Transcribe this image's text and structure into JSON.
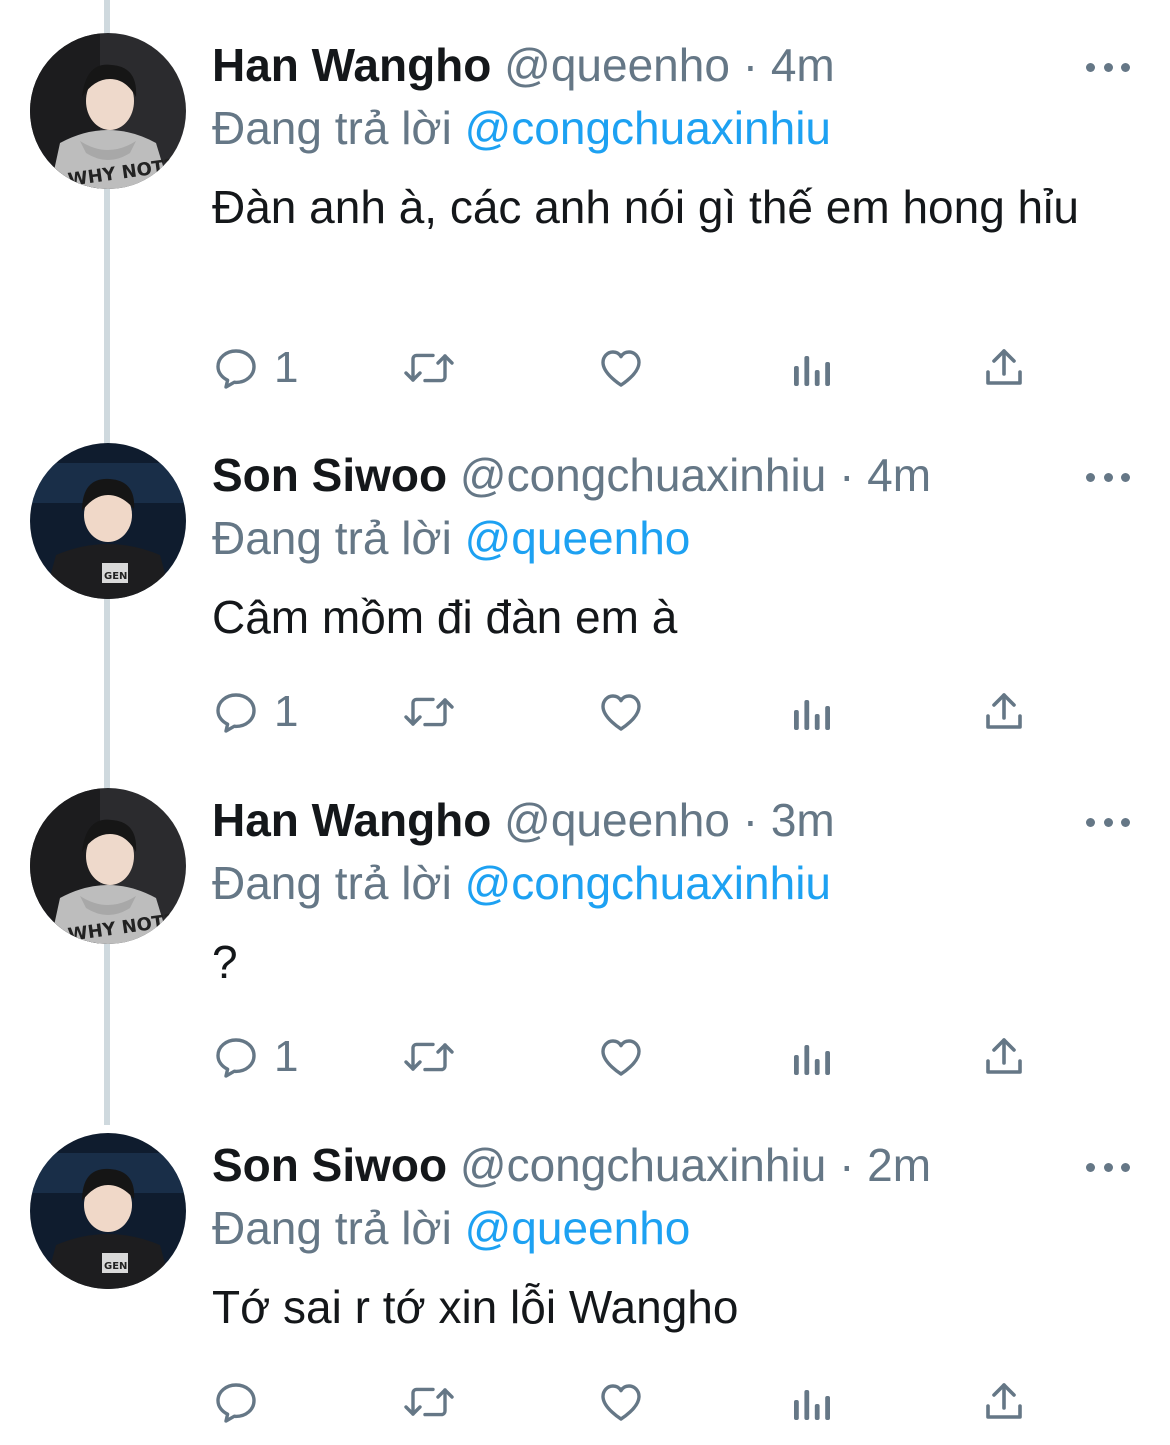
{
  "tweets": [
    {
      "name": "Han Wangho",
      "handle": "@queenho",
      "separator": "·",
      "time": "4m",
      "replying_prefix": "Đang trả lời",
      "replying_to": "@congchuaxinhiu",
      "text": "Đàn anh à, các anh nói gì thế em hong hỉu",
      "reply_count": "1",
      "avatar_shirt_text": "WHY NOT?!"
    },
    {
      "name": "Son Siwoo",
      "handle": "@congchuaxinhiu",
      "separator": "·",
      "time": "4m",
      "replying_prefix": "Đang trả lời",
      "replying_to": "@queenho",
      "text": "Câm mồm đi đàn em à",
      "reply_count": "1",
      "avatar_shirt_text": "GEN"
    },
    {
      "name": "Han Wangho",
      "handle": "@queenho",
      "separator": "·",
      "time": "3m",
      "replying_prefix": "Đang trả lời",
      "replying_to": "@congchuaxinhiu",
      "text": "?",
      "reply_count": "1",
      "avatar_shirt_text": "WHY NOT?!"
    },
    {
      "name": "Son Siwoo",
      "handle": "@congchuaxinhiu",
      "separator": "·",
      "time": "2m",
      "replying_prefix": "Đang trả lời",
      "replying_to": "@queenho",
      "text": "Tớ sai r tớ xin lỗi Wangho",
      "reply_count": "",
      "avatar_shirt_text": "GEN"
    }
  ],
  "colors": {
    "text": "#14171a",
    "secondary": "#657786",
    "link": "#1da1f2",
    "thread_line": "#cfd9de"
  },
  "icons": [
    "reply-icon",
    "retweet-icon",
    "like-icon",
    "views-icon",
    "share-icon",
    "more-icon"
  ]
}
